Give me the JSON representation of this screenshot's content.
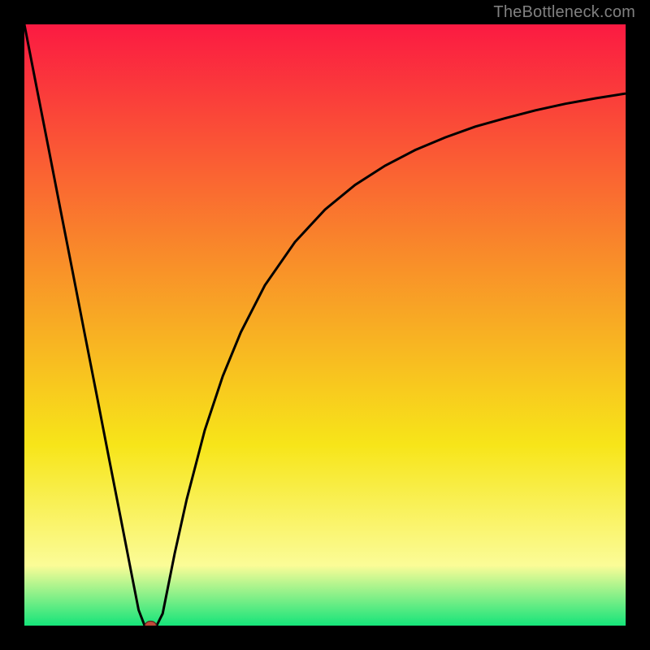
{
  "watermark": "TheBottleneck.com",
  "colors": {
    "bg": "#000000",
    "grad_top": "#fb1a42",
    "grad_mid1": "#f98a2a",
    "grad_mid2": "#f7e519",
    "grad_low": "#fbfc97",
    "grad_bottom": "#15e47a",
    "curve": "#000000",
    "marker_fill": "#c04a3a",
    "marker_stroke": "#5a2620"
  },
  "chart_data": {
    "type": "line",
    "title": "",
    "xlabel": "",
    "ylabel": "",
    "xlim": [
      0,
      100
    ],
    "ylim": [
      0,
      100
    ],
    "grid": false,
    "series": [
      {
        "name": "curve",
        "x": [
          0,
          2,
          4,
          6,
          8,
          10,
          12,
          14,
          16,
          18,
          19,
          20,
          21,
          22,
          23,
          25,
          27,
          30,
          33,
          36,
          40,
          45,
          50,
          55,
          60,
          65,
          70,
          75,
          80,
          85,
          90,
          95,
          100
        ],
        "y": [
          100,
          89.7,
          79.5,
          69.2,
          59.0,
          48.7,
          38.5,
          28.2,
          18.0,
          7.7,
          2.6,
          0.0,
          0.0,
          0.0,
          2.0,
          12.0,
          21.0,
          32.5,
          41.5,
          48.8,
          56.6,
          63.8,
          69.2,
          73.3,
          76.5,
          79.1,
          81.2,
          83.0,
          84.4,
          85.7,
          86.8,
          87.7,
          88.5
        ]
      }
    ],
    "marker": {
      "x": 21,
      "y": 0
    }
  }
}
